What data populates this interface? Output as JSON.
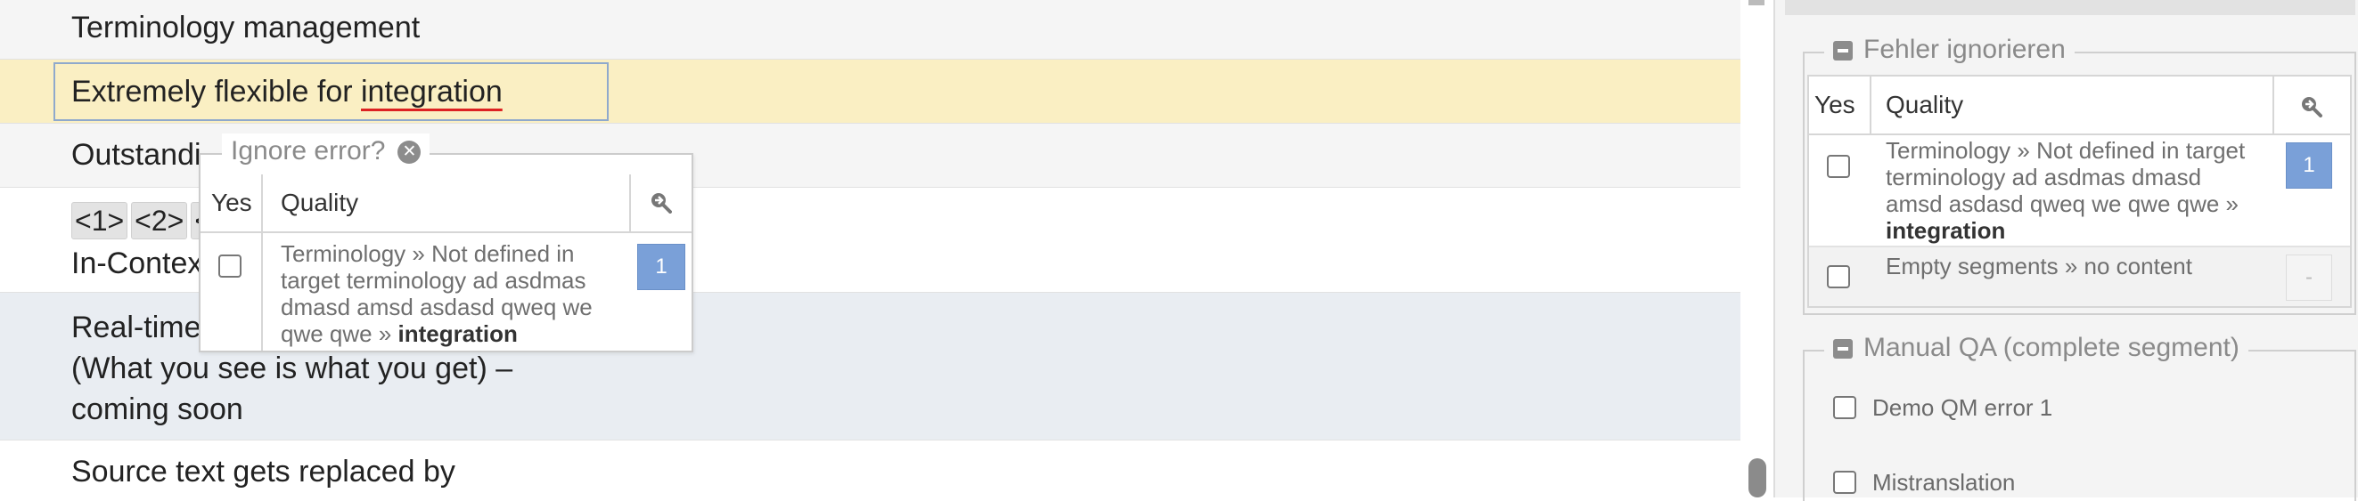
{
  "segments": [
    {
      "text": "Terminology management"
    },
    {
      "text_before": "Extremely flexible for ",
      "text_error": "integration"
    },
    {
      "text": "Outstandi"
    },
    {
      "tags": [
        "<1>",
        "<2>",
        "<"
      ],
      "line2": "In-Contex"
    },
    {
      "line1": "Real-time",
      "line2": "(What you see is what you get) –",
      "line3": "coming soon"
    },
    {
      "text": "Source text gets replaced by"
    }
  ],
  "popup": {
    "title": "Ignore error?",
    "col_yes": "Yes",
    "col_quality": "Quality",
    "row": {
      "text": "Terminology » Not defined in target terminology ad asdmas dmasd  amsd asdasd qweq we qwe qwe » ",
      "term": "integration",
      "count": "1"
    }
  },
  "panel": {
    "ignore_section": {
      "title": "Fehler ignorieren",
      "col_yes": "Yes",
      "col_quality": "Quality",
      "rows": [
        {
          "text": "Terminology » Not defined in target terminology ad asdmas dmasd  amsd asdasd qweq we qwe qwe » ",
          "term": "integration",
          "count": "1"
        },
        {
          "text": "Empty segments » no content",
          "count": "-"
        }
      ]
    },
    "manual_qa": {
      "title": "Manual QA (complete segment)",
      "items": [
        "Demo QM error 1",
        "Mistranslation"
      ]
    }
  },
  "colors": {
    "highlight_row": "#faefc3",
    "selected_row": "#e9edf2",
    "accent": "#7aa0d8",
    "error_underline": "#dd2222"
  }
}
